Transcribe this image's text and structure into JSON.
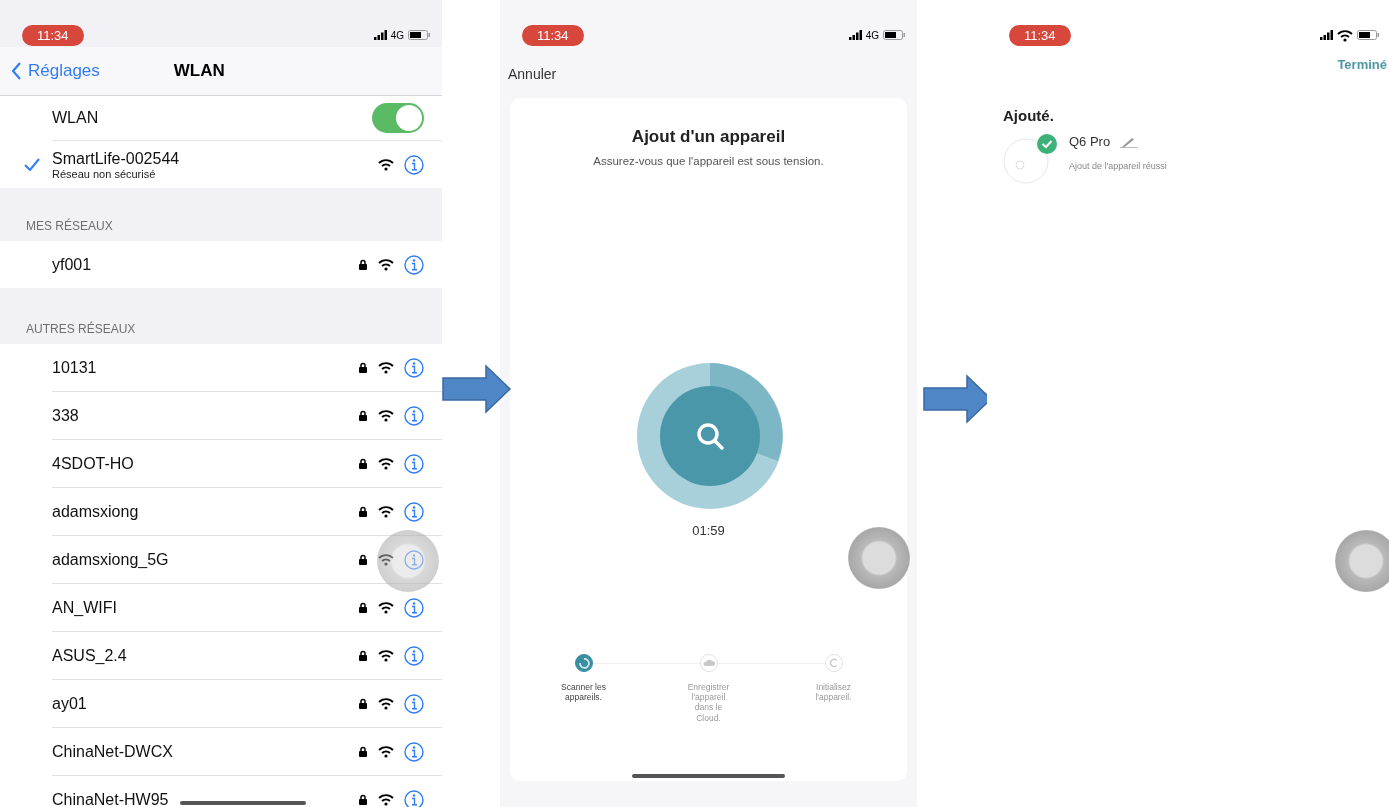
{
  "wifi_screen": {
    "status_bar": {
      "time": "11:34",
      "network": "4G"
    },
    "nav": {
      "back": "Réglages",
      "title": "WLAN"
    },
    "wlan_toggle": {
      "label": "WLAN",
      "on": true
    },
    "current_network": {
      "name": "SmartLife-002544",
      "detail": "Réseau non sécurisé",
      "connected": true
    },
    "sections": [
      {
        "header": "MES RÉSEAUX",
        "networks": [
          {
            "name": "yf001",
            "locked": true
          }
        ]
      },
      {
        "header": "AUTRES RÉSEAUX",
        "networks": [
          {
            "name": "10131",
            "locked": true
          },
          {
            "name": "338",
            "locked": true
          },
          {
            "name": "4SDOT-HO",
            "locked": true
          },
          {
            "name": "adamsxiong",
            "locked": true
          },
          {
            "name": "adamsxiong_5G",
            "locked": true
          },
          {
            "name": "AN_WIFI",
            "locked": true
          },
          {
            "name": "ASUS_2.4",
            "locked": true
          },
          {
            "name": "ay01",
            "locked": true
          },
          {
            "name": "ChinaNet-DWCX",
            "locked": true
          },
          {
            "name": "ChinaNet-HW95",
            "locked": true
          }
        ]
      }
    ]
  },
  "pairing_screen": {
    "status_bar": {
      "time": "11:34",
      "network": "4G"
    },
    "cancel": "Annuler",
    "title": "Ajout d'un appareil",
    "subtitle": "Assurez-vous que l'appareil est sous tension.",
    "timer": "01:59",
    "steps": [
      {
        "label": "Scanner les appareils.",
        "active": true
      },
      {
        "label": "Enregistrer l'appareil dans le Cloud.",
        "active": false
      },
      {
        "label": "Initialisez l'appareil.",
        "active": false
      }
    ]
  },
  "result_screen": {
    "status_bar": {
      "time": "11:34"
    },
    "done": "Terminé",
    "heading": "Ajouté.",
    "devices": [
      {
        "name": "Q6 Pro",
        "status": "Ajout de l'appareil réussi",
        "added": true
      }
    ]
  }
}
